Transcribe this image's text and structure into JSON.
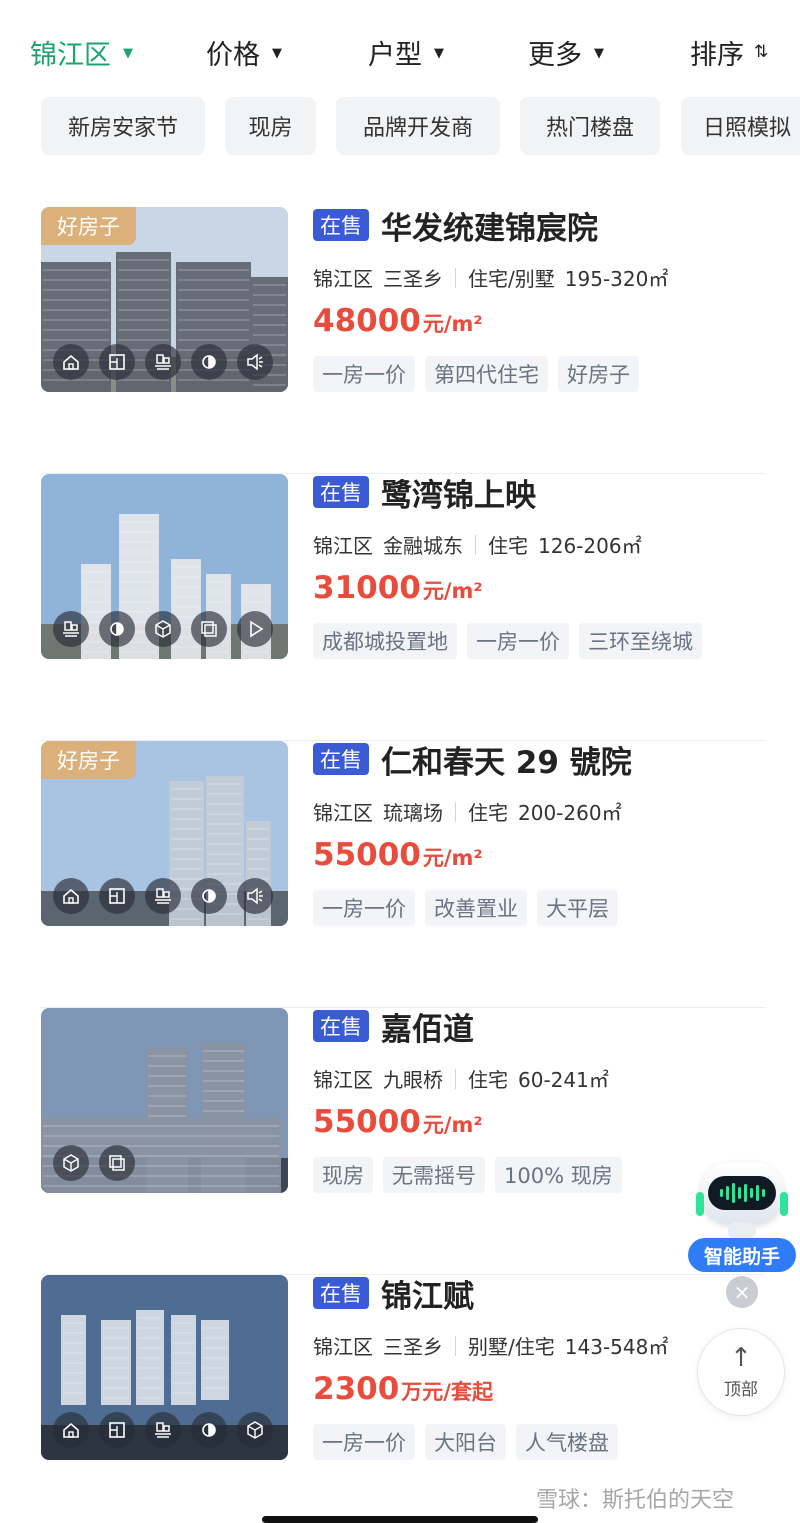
{
  "filters": [
    {
      "label": "锦江区",
      "active": true
    },
    {
      "label": "价格",
      "active": false
    },
    {
      "label": "户型",
      "active": false
    },
    {
      "label": "更多",
      "active": false
    },
    {
      "label": "排序",
      "active": false
    }
  ],
  "sort_icon": "⇅",
  "chips": [
    "新房安家节",
    "现房",
    "品牌开发商",
    "热门楼盘",
    "日照模拟"
  ],
  "listings": [
    {
      "good_badge": "好房子",
      "status": "在售",
      "name": "华发统建锦宸院",
      "district": "锦江区",
      "area": "三圣乡",
      "type": "住宅/别墅",
      "size": "195-320㎡",
      "price_num": "48000",
      "price_unit": "元/m²",
      "tags": [
        "一房一价",
        "第四代住宅",
        "好房子"
      ],
      "icons": [
        "home-icon",
        "floorplan-icon",
        "sandbox-icon",
        "sunlight-icon",
        "audio-icon"
      ],
      "sky": "#c9d6e6",
      "ground": "#8a8e8a",
      "building": "#5e646c"
    },
    {
      "good_badge": "",
      "status": "在售",
      "name": "鹭湾锦上映",
      "district": "锦江区",
      "area": "金融城东",
      "type": "住宅",
      "size": "126-206㎡",
      "price_num": "31000",
      "price_unit": "元/m²",
      "tags": [
        "成都城投置地",
        "一房一价",
        "三环至绕城"
      ],
      "icons": [
        "sandbox-icon",
        "sunlight-icon",
        "3d-icon",
        "vr-icon",
        "play-icon"
      ],
      "sky": "#8fb3d9",
      "ground": "#6e7772",
      "building": "#e6e8ec"
    },
    {
      "good_badge": "好房子",
      "status": "在售",
      "name": "仁和春天 29 號院",
      "district": "锦江区",
      "area": "琉璃场",
      "type": "住宅",
      "size": "200-260㎡",
      "price_num": "55000",
      "price_unit": "元/m²",
      "tags": [
        "一房一价",
        "改善置业",
        "大平层"
      ],
      "icons": [
        "home-icon",
        "floorplan-icon",
        "sandbox-icon",
        "sunlight-icon",
        "audio-icon"
      ],
      "sky": "#a9c4e2",
      "ground": "#5b6570",
      "building": "#c3ccd6"
    },
    {
      "good_badge": "",
      "status": "在售",
      "name": "嘉佰道",
      "district": "锦江区",
      "area": "九眼桥",
      "type": "住宅",
      "size": "60-241㎡",
      "price_num": "55000",
      "price_unit": "元/m²",
      "tags": [
        "现房",
        "无需摇号",
        "100% 现房"
      ],
      "icons": [
        "3d-icon",
        "vr-icon"
      ],
      "sky": "#7f97b4",
      "ground": "#3c4652",
      "building": "#8a93a3"
    },
    {
      "good_badge": "",
      "status": "在售",
      "name": "锦江赋",
      "district": "锦江区",
      "area": "三圣乡",
      "type": "别墅/住宅",
      "size": "143-548㎡",
      "price_num": "2300",
      "price_unit": "万元/套起",
      "tags": [
        "一房一价",
        "大阳台",
        "人气楼盘"
      ],
      "icons": [
        "home-icon",
        "floorplan-icon",
        "sandbox-icon",
        "sunlight-icon",
        "3d-icon"
      ],
      "sky": "#4f6d92",
      "ground": "#2c3540",
      "building": "#d9dfe8"
    }
  ],
  "assistant_label": "智能助手",
  "close_glyph": "×",
  "top_button": {
    "arrow": "↑",
    "label": "顶部"
  },
  "watermark": "雪球：斯托伯的天空",
  "colors": {
    "accent_green": "#1aa56e",
    "price_red": "#e84c3d",
    "sale_blue": "#3b5bd5",
    "badge_gold": "#dbb07a"
  }
}
